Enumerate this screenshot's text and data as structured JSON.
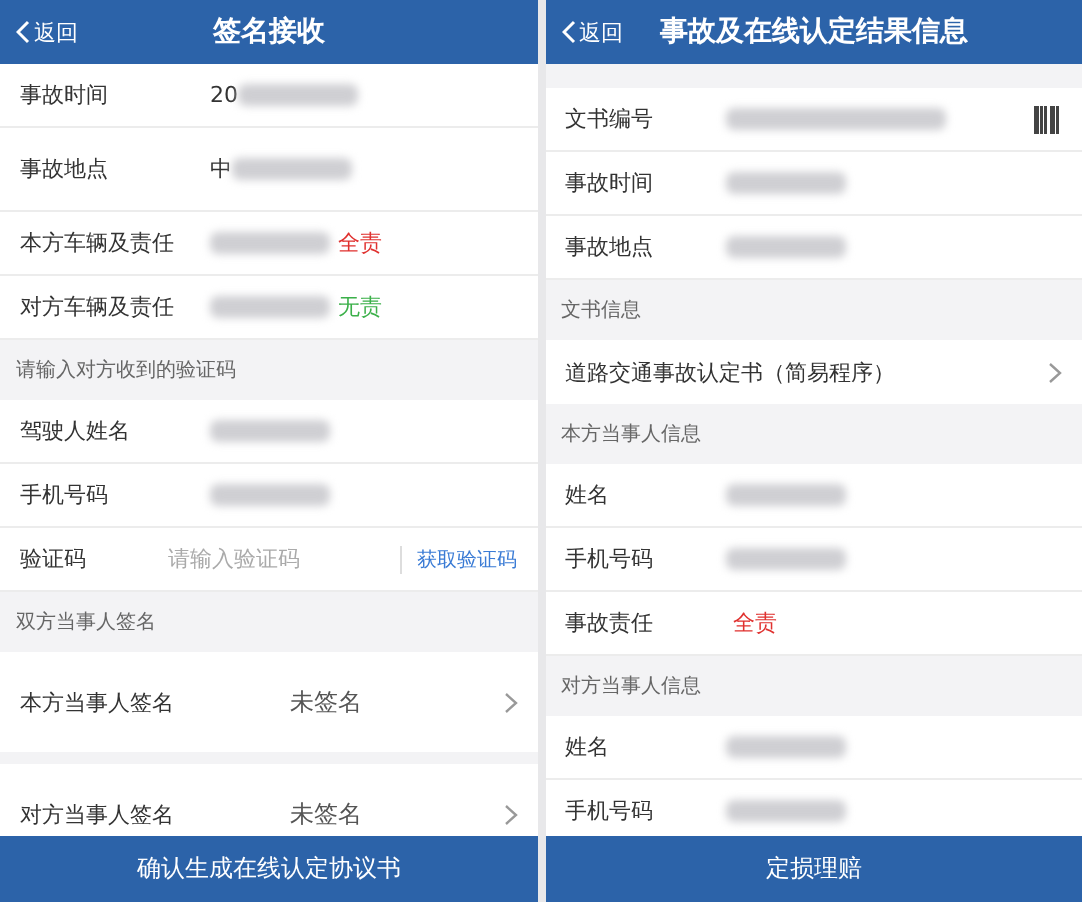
{
  "screens": [
    {
      "back": "返回",
      "title": "签名接收",
      "rows": [
        {
          "kind": "field",
          "label": "事故时间",
          "value": "20",
          "redacted": true
        },
        {
          "kind": "field",
          "label": "事故地点",
          "value": "中",
          "redacted": true
        },
        {
          "kind": "field",
          "label": "本方车辆及责任",
          "redacted": true,
          "tag": "全责",
          "color": "#e0312f"
        },
        {
          "kind": "field",
          "label": "对方车辆及责任",
          "redacted": true,
          "tag": "无责",
          "color": "#3cb04a"
        },
        {
          "kind": "section",
          "label": "请输入对方收到的验证码"
        },
        {
          "kind": "field",
          "label": "驾驶人姓名",
          "redacted": true
        },
        {
          "kind": "field",
          "label": "手机号码",
          "redacted": true
        },
        {
          "kind": "input",
          "label": "验证码",
          "placeholder": "请输入验证码",
          "action": "获取验证码"
        },
        {
          "kind": "section",
          "label": "双方当事人签名"
        },
        {
          "kind": "sign",
          "label": "本方当事人签名",
          "value": "未签名"
        },
        {
          "kind": "sign",
          "label": "对方当事人签名",
          "value": "未签名"
        }
      ],
      "button": "确认生成在线认定协议书"
    },
    {
      "back": "返回",
      "title": "事故及在线认定结果信息",
      "rows": [
        {
          "kind": "gap"
        },
        {
          "kind": "scan",
          "label": "文书编号",
          "redacted": true
        },
        {
          "kind": "field",
          "label": "事故时间",
          "redacted": true
        },
        {
          "kind": "field",
          "label": "事故地点",
          "redacted": true
        },
        {
          "kind": "section",
          "label": "文书信息"
        },
        {
          "kind": "link",
          "label": "道路交通事故认定书（简易程序）"
        },
        {
          "kind": "section",
          "label": "本方当事人信息"
        },
        {
          "kind": "field",
          "label": "姓名",
          "redacted": true
        },
        {
          "kind": "field",
          "label": "手机号码",
          "redacted": true
        },
        {
          "kind": "field",
          "label": "事故责任",
          "tag": "全责",
          "color": "#e0312f"
        },
        {
          "kind": "section",
          "label": "对方当事人信息"
        },
        {
          "kind": "field",
          "label": "姓名",
          "redacted": true
        },
        {
          "kind": "field",
          "label": "手机号码",
          "redacted": true
        }
      ],
      "button": "定损理赔"
    }
  ]
}
